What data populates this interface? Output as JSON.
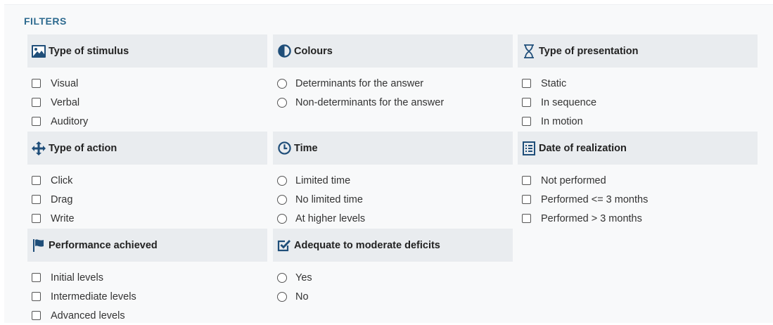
{
  "filters_title": "FILTERS",
  "groups": [
    {
      "title": "Type of stimulus",
      "icon": "image-icon",
      "control": "checkbox",
      "options": [
        "Visual",
        "Verbal",
        "Auditory"
      ]
    },
    {
      "title": "Colours",
      "icon": "contrast-icon",
      "control": "radio",
      "options": [
        "Determinants for the answer",
        "Non-determinants for the answer"
      ]
    },
    {
      "title": "Type of presentation",
      "icon": "hourglass-icon",
      "control": "checkbox",
      "options": [
        "Static",
        "In sequence",
        "In motion"
      ]
    },
    {
      "title": "Type of action",
      "icon": "move-icon",
      "control": "checkbox",
      "options": [
        "Click",
        "Drag",
        "Write"
      ]
    },
    {
      "title": "Time",
      "icon": "clock-icon",
      "control": "radio",
      "options": [
        "Limited time",
        "No limited time",
        "At higher levels"
      ]
    },
    {
      "title": "Date of realization",
      "icon": "list-alt-icon",
      "control": "checkbox",
      "options": [
        "Not performed",
        "Performed <= 3 months",
        "Performed > 3 months"
      ]
    },
    {
      "title": "Performance achieved",
      "icon": "flag-icon",
      "control": "checkbox",
      "options": [
        "Initial levels",
        "Intermediate levels",
        "Advanced levels"
      ]
    },
    {
      "title": "Adequate to moderate deficits",
      "icon": "check-square-icon",
      "control": "radio",
      "options": [
        "Yes",
        "No"
      ]
    }
  ]
}
